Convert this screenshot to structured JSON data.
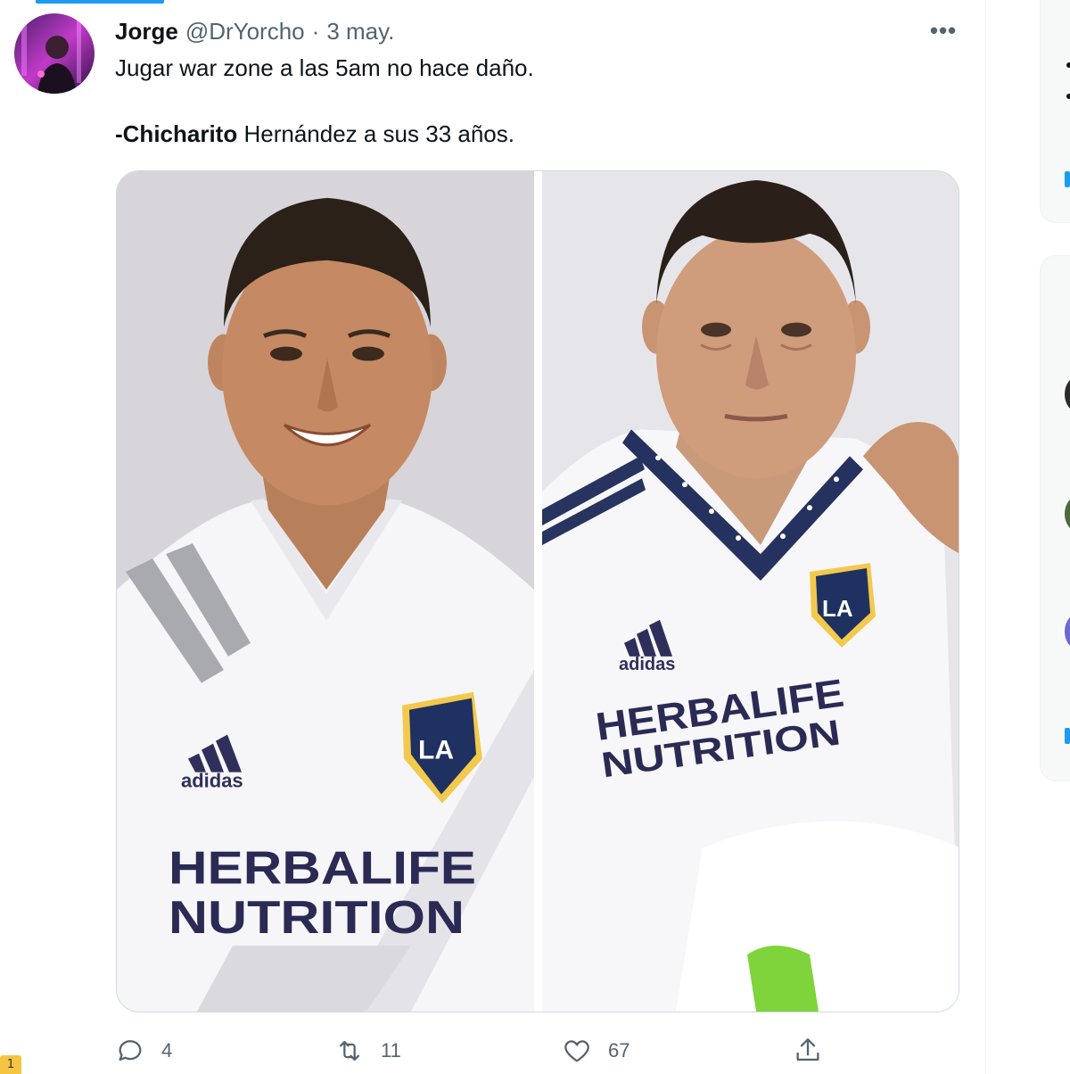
{
  "tweet": {
    "author_name": "Jorge",
    "author_handle": "@DrYorcho",
    "separator": "·",
    "date": "3 may.",
    "more_label": "•••",
    "text_line1": "Jugar war zone a las 5am no hace daño.",
    "text_line2_bold": "-Chicharito",
    "text_line2_rest": " Hernández a sus 33 años.",
    "media": {
      "left_photo": {
        "icon": "player-smiling-photo",
        "sponsor_line1": "HERBALIFE",
        "sponsor_line2": "NUTRITION",
        "brand": "adidas",
        "crest": "LA"
      },
      "right_photo": {
        "icon": "player-tired-photo",
        "sponsor_line1": "HERBALIFE",
        "sponsor_line2": "NUTRITION",
        "brand": "adidas",
        "crest": "LA"
      }
    },
    "actions": {
      "reply_count": "4",
      "retweet_count": "11",
      "like_count": "67"
    }
  },
  "badge_label": "1",
  "colors": {
    "accent": "#1d9bf0",
    "text": "#0f1419",
    "muted": "#536471",
    "border": "#cfd9de"
  }
}
